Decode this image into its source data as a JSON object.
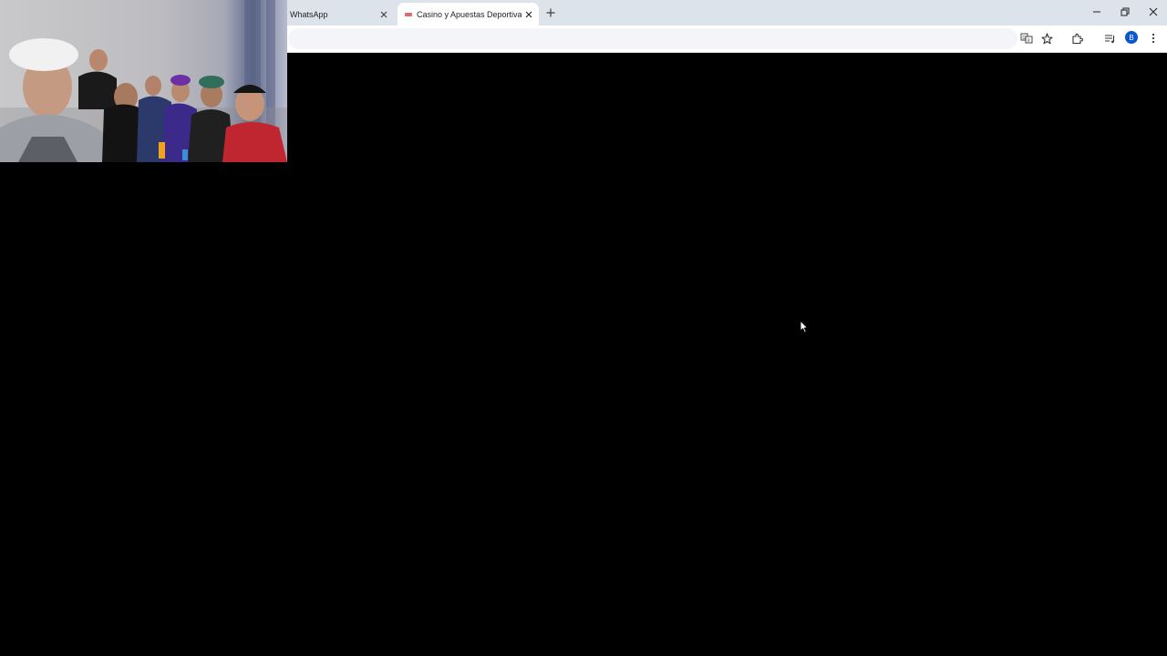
{
  "browser": {
    "tabs": [
      {
        "title": "WhatsApp",
        "active": false
      },
      {
        "title": "Casino y Apuestas Deportivas B",
        "active": true
      }
    ],
    "profile_initial": "B"
  },
  "icons": {
    "tab_close": "close-icon",
    "new_tab": "plus-icon",
    "minimize": "minimize-icon",
    "restore": "restore-icon",
    "close_window": "close-icon",
    "translate": "translate-icon",
    "bookmark": "star-icon",
    "extensions": "puzzle-icon",
    "media": "media-control-icon",
    "menu": "kebab-menu-icon"
  },
  "colors": {
    "tabstrip": "#dde3ea",
    "active_tab": "#ffffff",
    "page_background": "#000000",
    "avatar": "#0b57d0"
  }
}
